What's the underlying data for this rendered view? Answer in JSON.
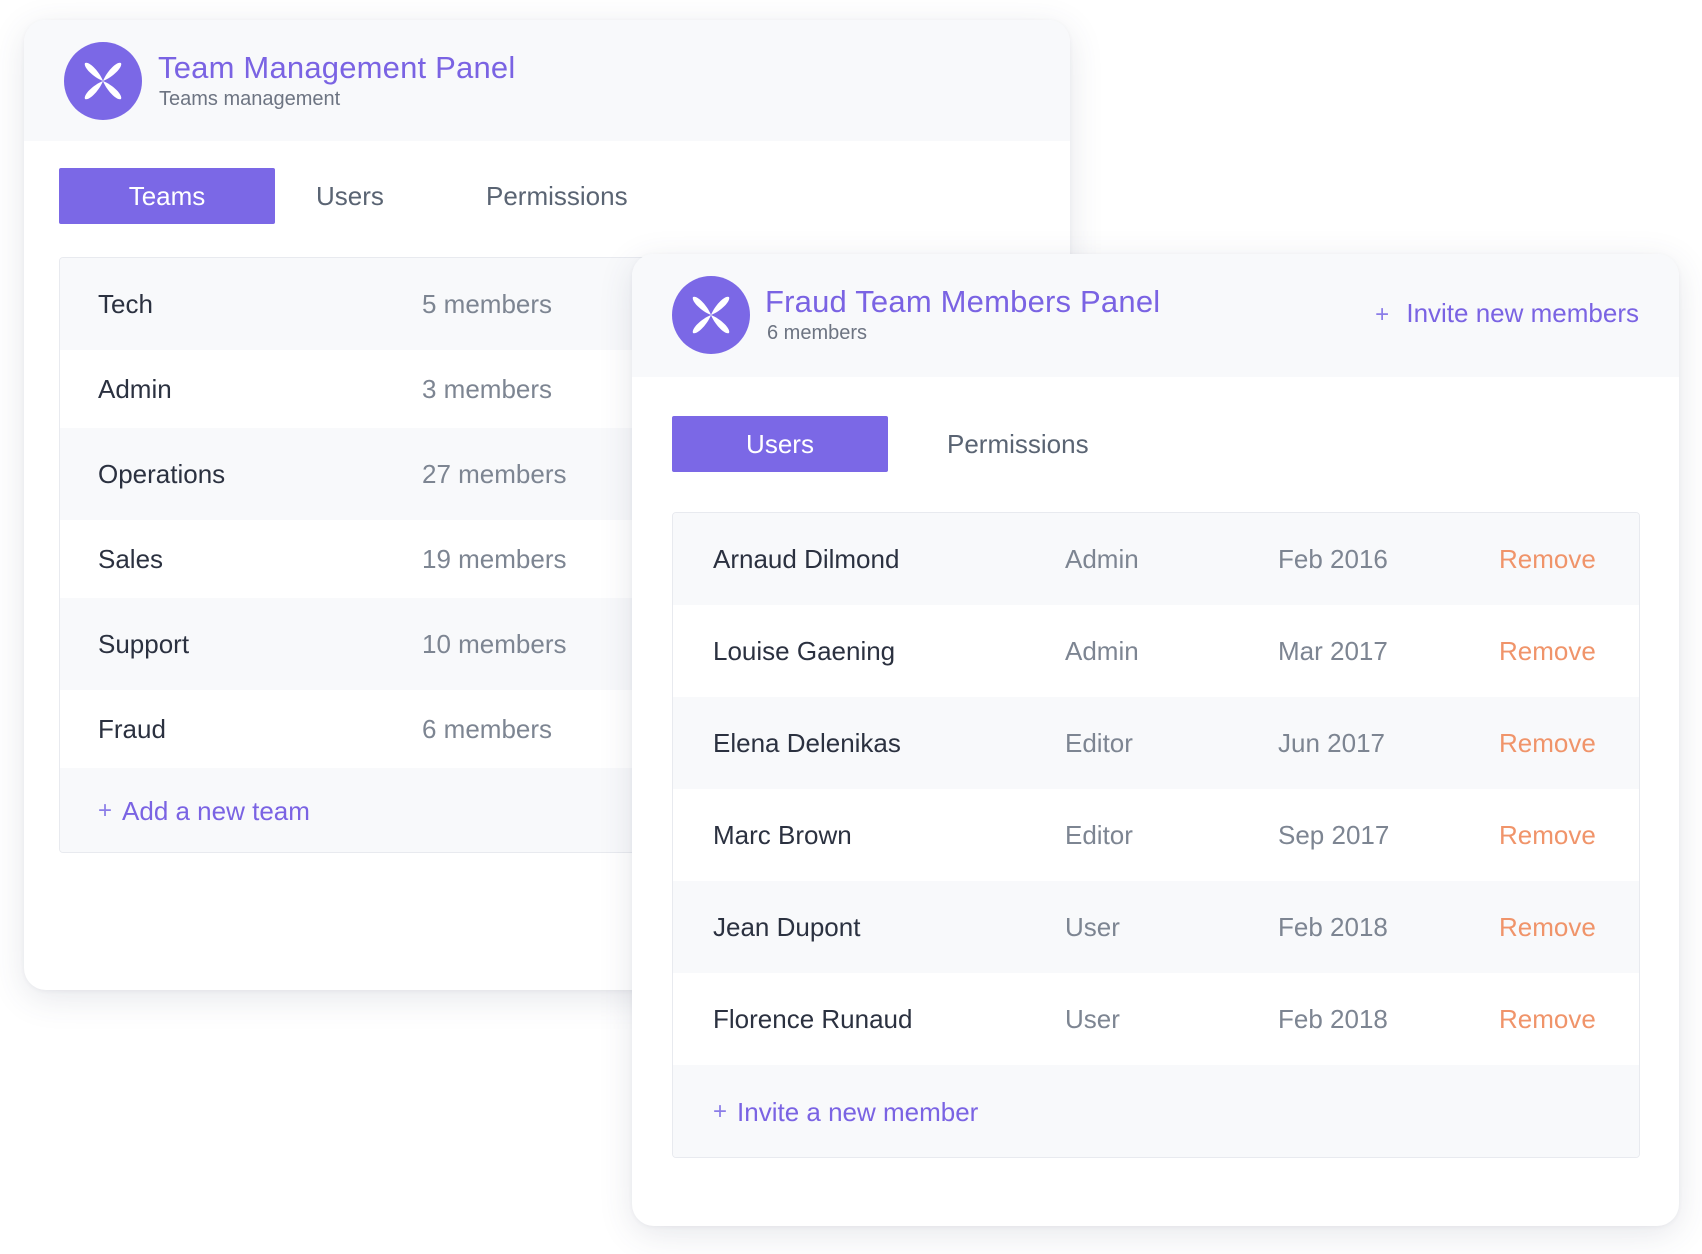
{
  "colors": {
    "accent": "#7b68e6",
    "remove": "#f0946a",
    "header_bg": "#f8f9fb"
  },
  "teams_panel": {
    "logo_icon": "flower-icon",
    "title": "Team Management Panel",
    "subtitle": "Teams management",
    "tabs": [
      {
        "label": "Teams",
        "active": true
      },
      {
        "label": "Users",
        "active": false
      },
      {
        "label": "Permissions",
        "active": false
      }
    ],
    "teams": [
      {
        "name": "Tech",
        "count": "5 members"
      },
      {
        "name": "Admin",
        "count": "3 members"
      },
      {
        "name": "Operations",
        "count": "27 members"
      },
      {
        "name": "Sales",
        "count": "19 members"
      },
      {
        "name": "Support",
        "count": "10 members"
      },
      {
        "name": "Fraud",
        "count": "6 members"
      }
    ],
    "add_team_label": "Add a new team",
    "plus_symbol": "+"
  },
  "members_panel": {
    "logo_icon": "flower-icon",
    "title": "Fraud Team Members Panel",
    "subtitle": "6 members",
    "invite_header_label": "Invite new members",
    "tabs": [
      {
        "label": "Users",
        "active": true
      },
      {
        "label": "Permissions",
        "active": false
      }
    ],
    "members": [
      {
        "name": "Arnaud Dilmond",
        "role": "Admin",
        "since": "Feb 2016",
        "action": "Remove"
      },
      {
        "name": "Louise Gaening",
        "role": "Admin",
        "since": "Mar 2017",
        "action": "Remove"
      },
      {
        "name": "Elena Delenikas",
        "role": "Editor",
        "since": "Jun 2017",
        "action": "Remove"
      },
      {
        "name": "Marc Brown",
        "role": "Editor",
        "since": "Sep 2017",
        "action": "Remove"
      },
      {
        "name": "Jean Dupont",
        "role": "User",
        "since": "Feb 2018",
        "action": "Remove"
      },
      {
        "name": "Florence Runaud",
        "role": "User",
        "since": "Feb 2018",
        "action": "Remove"
      }
    ],
    "invite_member_label": "Invite a new member",
    "plus_symbol": "+"
  }
}
